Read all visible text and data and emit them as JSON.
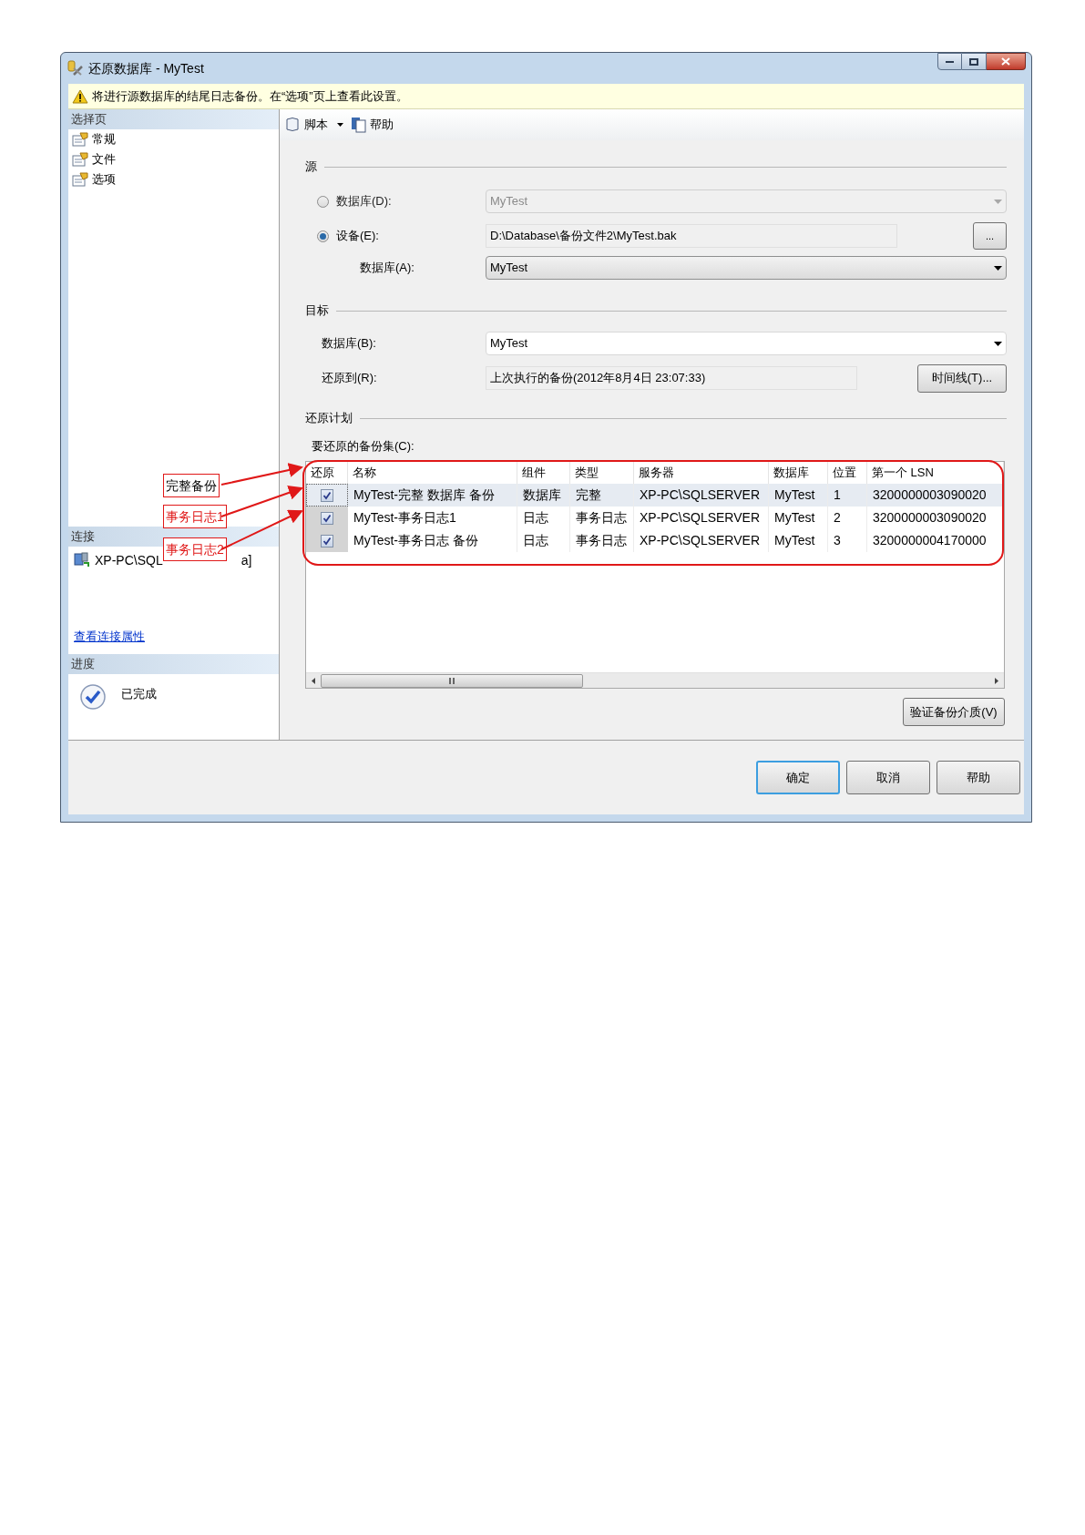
{
  "window": {
    "title": "还原数据库 - MyTest"
  },
  "warning": "将进行源数据库的结尾日志备份。在“选项”页上查看此设置。",
  "sidebar": {
    "header": "选择页",
    "items": [
      {
        "label": "常规"
      },
      {
        "label": "文件"
      },
      {
        "label": "选项"
      }
    ]
  },
  "connection": {
    "header": "连接",
    "server_visible": "XP-PC\\SQL",
    "server_tail": "a]",
    "link": "查看连接属性"
  },
  "progress": {
    "header": "进度",
    "status": "已完成"
  },
  "toolbar": {
    "items": [
      {
        "label": "脚本",
        "kind": "dropdown"
      },
      {
        "label": "帮助",
        "kind": "help"
      }
    ]
  },
  "source": {
    "title": "源",
    "database_option": {
      "label": "数据库(D):",
      "selected": false,
      "value": "MyTest",
      "disabled": true
    },
    "device_option": {
      "label": "设备(E):",
      "selected": true,
      "value": "D:\\Database\\备份文件2\\MyTest.bak",
      "button": "..."
    },
    "database": {
      "label": "数据库(A):",
      "value": "MyTest"
    }
  },
  "target": {
    "title": "目标",
    "database": {
      "label": "数据库(B):",
      "value": "MyTest"
    },
    "restore_to": {
      "label": "还原到(R):",
      "value": "上次执行的备份(2012年8月4日 23:07:33)",
      "button": "时间线(T)..."
    }
  },
  "plan": {
    "title": "还原计划",
    "grid_label": "要还原的备份集(C):",
    "table": {
      "check_column": "还原",
      "columns": [
        "名称",
        "组件",
        "类型",
        "服务器",
        "数据库",
        "位置",
        "第一个 LSN"
      ],
      "rows": [
        {
          "checked": true,
          "selected": true,
          "cells": [
            "MyTest-完整 数据库 备份",
            "数据库",
            "完整",
            "XP-PC\\SQLSERVER",
            "MyTest",
            "1",
            "3200000003090020"
          ]
        },
        {
          "checked": true,
          "selected": false,
          "cells": [
            "MyTest-事务日志1",
            "日志",
            "事务日志",
            "XP-PC\\SQLSERVER",
            "MyTest",
            "2",
            "3200000003090020"
          ]
        },
        {
          "checked": true,
          "selected": false,
          "cells": [
            "MyTest-事务日志  备份",
            "日志",
            "事务日志",
            "XP-PC\\SQLSERVER",
            "MyTest",
            "3",
            "3200000004170000"
          ]
        }
      ]
    },
    "verify_button": "验证备份介质(V)"
  },
  "buttons": [
    {
      "label": "确定",
      "default": true
    },
    {
      "label": "取消",
      "default": false
    },
    {
      "label": "帮助",
      "default": false
    }
  ],
  "annotations": [
    {
      "text": "完整备份",
      "color": "#000000"
    },
    {
      "text": "事务日志1",
      "color": "#e01818"
    },
    {
      "text": "事务日志2",
      "color": "#e01818"
    }
  ]
}
